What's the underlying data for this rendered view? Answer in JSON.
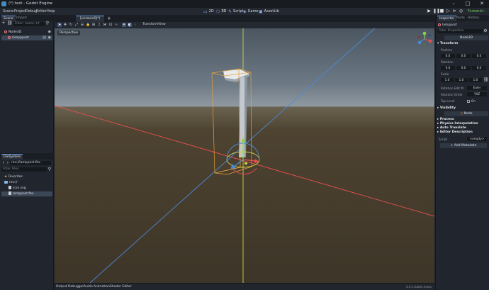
{
  "window": {
    "title": "(*) test - Godot Engine",
    "minimize": "–",
    "maximize": "□",
    "close": "✕"
  },
  "menu": [
    "Scene",
    "Project",
    "Debug",
    "Editor",
    "Help"
  ],
  "workspaces": [
    {
      "label": "2D",
      "icon": "2d-icon"
    },
    {
      "label": "3D",
      "icon": "3d-icon"
    },
    {
      "label": "Script",
      "icon": "script-icon"
    },
    {
      "label": "Game",
      "icon": "game-icon"
    },
    {
      "label": "AssetLib",
      "icon": "assetlib-icon"
    }
  ],
  "renderer": "Forward+",
  "scene_dock": {
    "tabs": [
      "Scene",
      "Import"
    ],
    "filter_placeholder": "Filter: name, t:t",
    "tree": [
      {
        "label": "Node3D",
        "level": 0
      },
      {
        "label": "lampppost",
        "level": 1
      }
    ]
  },
  "filesystem_dock": {
    "tab": "FileSystem",
    "path": "res://lamppost.fbx",
    "filter_placeholder": "Filter Files",
    "items": [
      {
        "label": "Favorites",
        "type": "favorites"
      },
      {
        "label": "res://",
        "type": "folder"
      },
      {
        "label": "icon.svg",
        "type": "file"
      },
      {
        "label": "lamppost.fbx",
        "type": "file"
      }
    ]
  },
  "editor": {
    "scene_tab": "[unsaved](*)",
    "add_tab": "+",
    "toolbar_menus": [
      "Transform",
      "View"
    ],
    "viewport_label": "Perspective"
  },
  "bottom_panel": {
    "tabs": [
      "Output",
      "Debugger",
      "Audio",
      "Animation",
      "Shader Editor"
    ],
    "version": "4.4.1.stable.mono"
  },
  "inspector": {
    "tabs": [
      "Inspector",
      "Node",
      "History"
    ],
    "object": "lamppost",
    "filter_placeholder": "Filter Properties",
    "class_badge": "Node3D",
    "transform_label": "Transform",
    "position_label": "Position",
    "position": {
      "x": "0.0",
      "y": "0.0",
      "z": "0.0"
    },
    "rotation_label": "Rotation",
    "rotation": {
      "x": "0.0",
      "y": "0.0",
      "z": "0.0"
    },
    "scale_label": "Scale",
    "scale": {
      "x": "1.0",
      "y": "1.0",
      "z": "1.0"
    },
    "rotation_edit_mode_label": "Rotation Edit M",
    "rotation_edit_mode": "Euler",
    "rotation_order_label": "Rotation Order",
    "rotation_order": "YXZ",
    "top_level_label": "Top Level",
    "top_level_value": "On",
    "visibility_label": "Visibility",
    "node_badge": "Node",
    "process_label": "Process",
    "physics_label": "Physics Interpolation",
    "auto_translate_label": "Auto Translate",
    "editor_desc_label": "Editor Description",
    "script_label": "Script",
    "script_value": "<empty>",
    "add_metadata": "Add Metadata"
  },
  "colors": {
    "x_axis": "#e85050",
    "y_axis": "#c9d54a",
    "z_axis": "#4a8bd8",
    "selection": "#e8a23a"
  }
}
